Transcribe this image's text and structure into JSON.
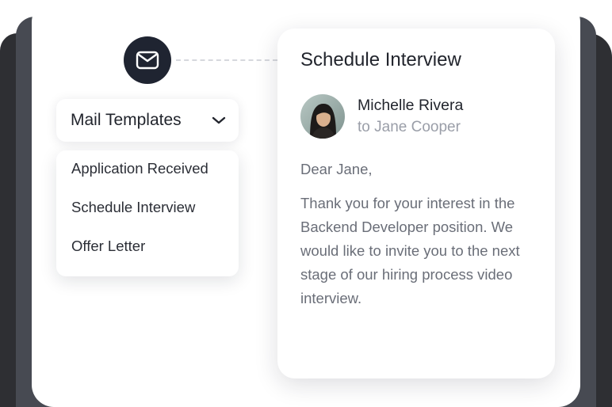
{
  "app": {
    "accent": "#1f2431",
    "background_stack": [
      "#2e2f33",
      "#474a52"
    ]
  },
  "templates": {
    "dropdown_label": "Mail Templates",
    "dropdown_icon": "chevron-down-icon",
    "trigger_icon": "mail-icon",
    "items": [
      {
        "label": "Application Received"
      },
      {
        "label": "Schedule Interview"
      },
      {
        "label": "Offer Letter"
      }
    ]
  },
  "email": {
    "title": "Schedule Interview",
    "sender_name": "Michelle Rivera",
    "recipient": "to Jane Cooper",
    "greeting": "Dear Jane,",
    "body": "Thank you for your interest in the Backend Developer position. We would like to invite you to the next stage of our hiring process video interview."
  }
}
